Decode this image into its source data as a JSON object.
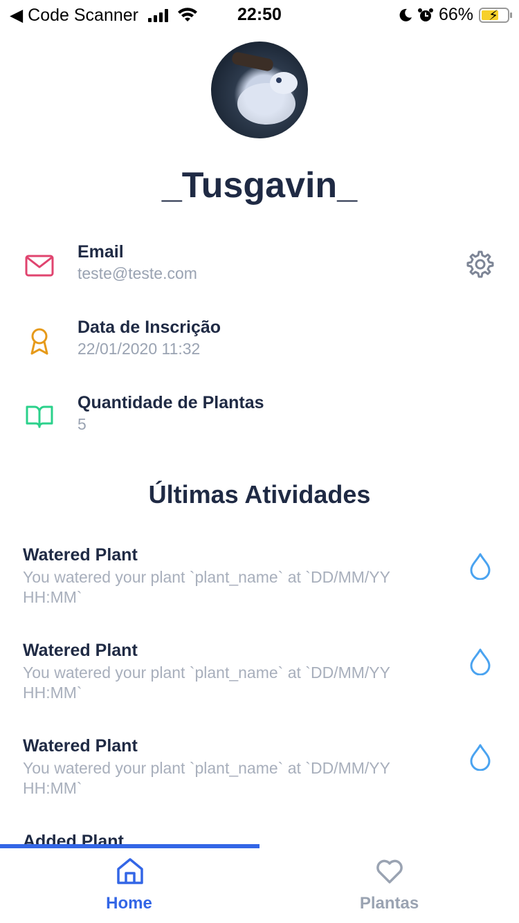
{
  "status_bar": {
    "back_label": "◀ Code Scanner",
    "time": "22:50",
    "battery_percent": "66%"
  },
  "profile": {
    "username": "_Tusgavin_"
  },
  "info": [
    {
      "title": "Email",
      "value": "teste@teste.com",
      "icon": "mail-icon",
      "color": "#e0446f"
    },
    {
      "title": "Data de Inscrição",
      "value": "22/01/2020 11:32",
      "icon": "award-icon",
      "color": "#e69a1a"
    },
    {
      "title": "Quantidade de Plantas",
      "value": "5",
      "icon": "book-open-icon",
      "color": "#2bd18b"
    }
  ],
  "activities_section": {
    "title": "Últimas Atividades"
  },
  "activities": [
    {
      "title": "Watered Plant",
      "description": "You watered your plant `plant_name` at `DD/MM/YY HH:MM`",
      "icon": "droplet-icon"
    },
    {
      "title": "Watered Plant",
      "description": "You watered your plant `plant_name` at `DD/MM/YY HH:MM`",
      "icon": "droplet-icon"
    },
    {
      "title": "Watered Plant",
      "description": "You watered your plant `plant_name` at `DD/MM/YY HH:MM`",
      "icon": "droplet-icon"
    },
    {
      "title": "Added Plant",
      "description": "",
      "icon": ""
    }
  ],
  "tabs": [
    {
      "label": "Home",
      "icon": "home-icon",
      "active": true
    },
    {
      "label": "Plantas",
      "icon": "heart-icon",
      "active": false
    }
  ],
  "colors": {
    "accent": "#3366e6",
    "text_dark": "#1f2a44",
    "text_muted": "#9aa3b2",
    "droplet": "#4aa3f0"
  }
}
